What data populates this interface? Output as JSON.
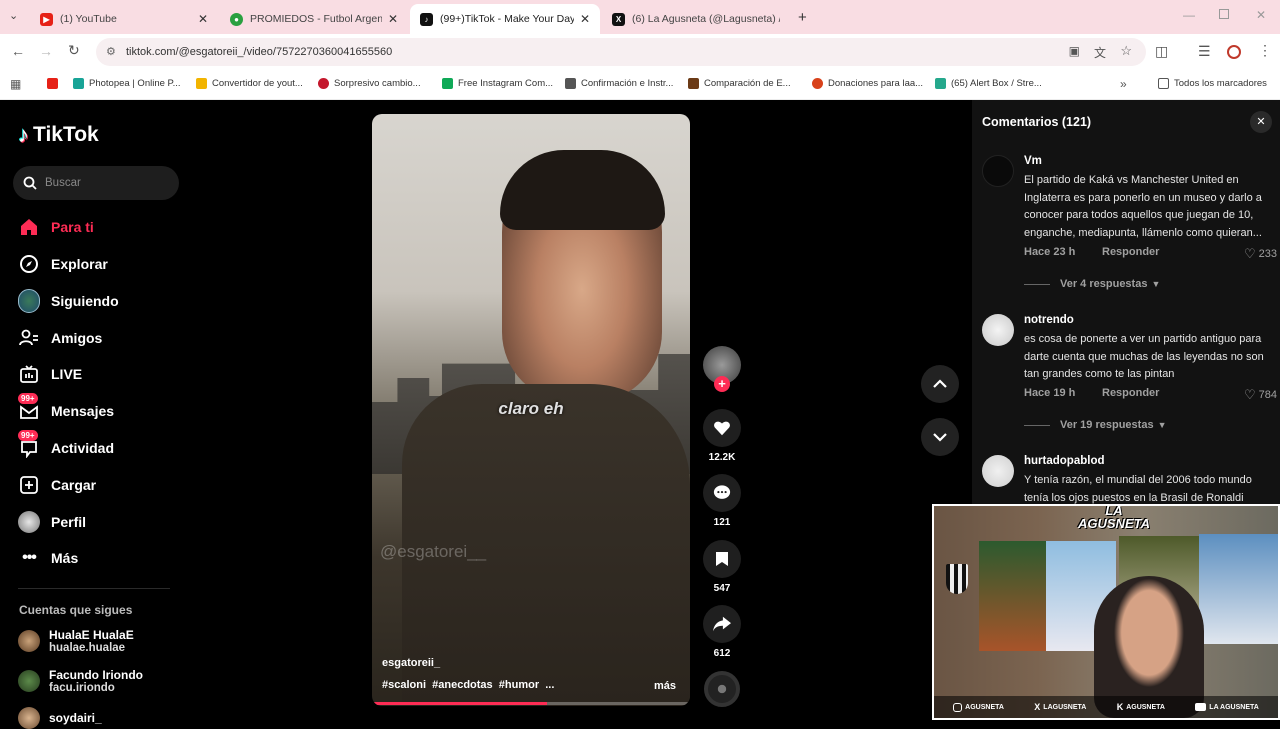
{
  "browser": {
    "tabs": [
      {
        "title": "(1) YouTube",
        "icon": "youtube-icon",
        "color": "#e62117"
      },
      {
        "title": "PROMIEDOS - Futbol Argentino",
        "icon": "soccer-ball-icon",
        "color": "#2aa040"
      },
      {
        "title": "(99+)TikTok - Make Your Day",
        "icon": "tiktok-icon",
        "color": "#111111"
      },
      {
        "title": "(6) La Agusneta (@Lagusneta) /",
        "icon": "x-icon",
        "color": "#111111"
      }
    ],
    "url": "tiktok.com/@esgatoreii_/video/7572270360041655560",
    "bookmarks": [
      {
        "label": "",
        "color": "#e62117"
      },
      {
        "label": "Photopea | Online P...",
        "color": "#18a497"
      },
      {
        "label": "Convertidor de yout...",
        "color": "#f2b400"
      },
      {
        "label": "Sorpresivo cambio...",
        "color": "#c4172c"
      },
      {
        "label": "Free Instagram Com...",
        "color": "#0fa957"
      },
      {
        "label": "Confirmación e Instr...",
        "color": "#555555"
      },
      {
        "label": "Comparación de E...",
        "color": "#6b3a16"
      },
      {
        "label": "Donaciones para laa...",
        "color": "#d8411a"
      },
      {
        "label": "(65) Alert Box / Stre...",
        "color": "#25a88c"
      }
    ],
    "all_bookmarks": "Todos los marcadores"
  },
  "tiktok": {
    "logo": "TikTok",
    "search_placeholder": "Buscar",
    "nav": [
      {
        "label": "Para ti",
        "icon": "home-icon",
        "active": true
      },
      {
        "label": "Explorar",
        "icon": "compass-icon"
      },
      {
        "label": "Siguiendo",
        "icon": "following-avatar-icon"
      },
      {
        "label": "Amigos",
        "icon": "friends-icon"
      },
      {
        "label": "LIVE",
        "icon": "live-icon"
      },
      {
        "label": "Mensajes",
        "icon": "messages-icon",
        "badge": "99+"
      },
      {
        "label": "Actividad",
        "icon": "activity-icon",
        "badge": "99+"
      },
      {
        "label": "Cargar",
        "icon": "upload-icon"
      },
      {
        "label": "Perfil",
        "icon": "profile-icon"
      },
      {
        "label": "Más",
        "icon": "more-icon"
      }
    ],
    "following_title": "Cuentas que sigues",
    "following": [
      {
        "name": "HualaE HualaE",
        "handle": "hualae.hualae"
      },
      {
        "name": "Facundo Iriondo",
        "handle": "facu.iriondo"
      },
      {
        "name": "soydairi_",
        "handle": ""
      }
    ],
    "video": {
      "caption": "claro eh",
      "watermark": "@esgatorei__",
      "author": "esgatoreii_",
      "hashtags": "#scaloni  #anecdotas  #humor  ...",
      "more": "más",
      "progress": 0.55
    },
    "actions": {
      "likes": "12.2K",
      "comments": "121",
      "saves": "547",
      "shares": "612"
    },
    "comments_panel": {
      "title": "Comentarios (121)",
      "items": [
        {
          "user": "Vm",
          "text": "El partido de Kaká vs Manchester United en Inglaterra es para ponerlo en un museo y darlo a conocer para todos aquellos que juegan de 10, enganche, mediapunta, llámenlo como quieran...",
          "time": "Hace 23 h",
          "reply": "Responder",
          "likes": "233",
          "replies": "Ver 4 respuestas"
        },
        {
          "user": "notrendo",
          "text": "es cosa de ponerte a ver un partido antiguo para darte cuenta que muchas de las leyendas no son tan grandes como te las pintan",
          "time": "Hace 19 h",
          "reply": "Responder",
          "likes": "784",
          "replies": "Ver 19 respuestas"
        },
        {
          "user": "hurtadopablod",
          "text": "Y tenía razón, el mundial del 2006 todo mundo tenía los ojos puestos en la Brasil de Ronaldi",
          "time": "",
          "reply": "",
          "likes": "",
          "replies": ""
        }
      ]
    }
  },
  "overlay": {
    "logo": "LA AGUSNETA",
    "socials": [
      "AGUSNETA",
      "LAGUSNETA",
      "AGUSNETA",
      "LA AGUSNETA"
    ]
  }
}
